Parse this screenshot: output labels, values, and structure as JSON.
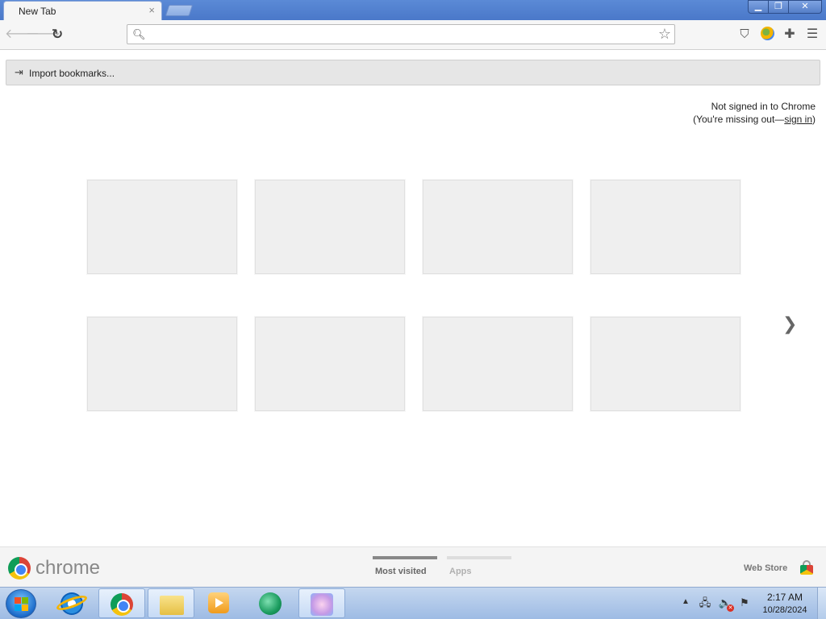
{
  "window": {
    "tab_title": "New Tab",
    "tab_close_glyph": "×",
    "minimize_glyph": "▁",
    "restore_glyph": "❐",
    "close_glyph": "✕"
  },
  "toolbar": {
    "back_icon": "back-arrow-icon",
    "forward_icon": "forward-arrow-icon",
    "reload_icon": "reload-icon",
    "omnibox_value": "",
    "omnibox_placeholder": "",
    "extensions": [
      "pocket-icon",
      "avatar-icon",
      "puzzle-icon",
      "menu-icon"
    ]
  },
  "import_bar": {
    "label": "Import bookmarks..."
  },
  "signin": {
    "line1": "Not signed in to Chrome",
    "line2_prefix": "(You're missing out—",
    "link": "sign in",
    "line2_suffix": ")"
  },
  "tiles": [
    "",
    "",
    "",
    "",
    "",
    "",
    "",
    ""
  ],
  "pager": {
    "next_glyph": "❯"
  },
  "footer": {
    "brand": "chrome",
    "tabs": [
      {
        "label": "Most visited",
        "selected": true
      },
      {
        "label": "Apps",
        "selected": false
      }
    ],
    "webstore_label": "Web Store"
  },
  "taskbar": {
    "items": [
      "start-orb",
      "internet-explorer-icon",
      "chrome-icon",
      "file-explorer-icon",
      "media-player-icon",
      "green-app-icon",
      "paint-app-icon"
    ],
    "clock_time": "2:17 AM",
    "clock_date": "10/28/2024",
    "tray_up_glyph": "▲"
  },
  "colors": {
    "titlebar": "#4a78c9",
    "toolbar": "#f6f6f6",
    "tile": "#efefef",
    "taskbar": "#9ebbe4"
  }
}
